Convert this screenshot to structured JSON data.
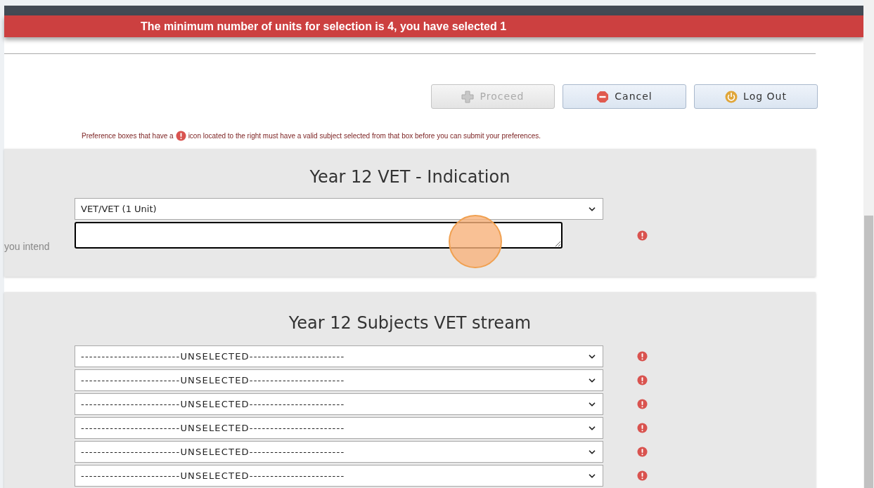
{
  "alert": {
    "message": "The minimum number of units for selection is 4, you have selected 1"
  },
  "buttons": [
    {
      "kind": "plus",
      "label": "Proceed",
      "disabled": true
    },
    {
      "kind": "stop",
      "label": "Cancel",
      "disabled": false
    },
    {
      "kind": "power",
      "label": "Log Out",
      "disabled": false
    }
  ],
  "note": {
    "before": "Preference boxes that have a",
    "after": "icon located to the right must have a valid subject selected from that box before you can submit your preferences."
  },
  "sections": [
    {
      "title": "Year 12 VET - Indication",
      "side_label": "you intend",
      "rows": [
        {
          "kind": "dropdown",
          "value": "VET/VET (1 Unit)",
          "warning": false
        },
        {
          "kind": "textarea",
          "value": "",
          "warning": true
        }
      ]
    },
    {
      "title": "Year 12 Subjects VET stream",
      "rows": [
        {
          "kind": "dropdown",
          "value": "------------------------UNSELECTED-----------------------",
          "warning": true
        },
        {
          "kind": "dropdown",
          "value": "------------------------UNSELECTED-----------------------",
          "warning": true
        },
        {
          "kind": "dropdown",
          "value": "------------------------UNSELECTED-----------------------",
          "warning": true
        },
        {
          "kind": "dropdown",
          "value": "------------------------UNSELECTED-----------------------",
          "warning": true
        },
        {
          "kind": "dropdown",
          "value": "------------------------UNSELECTED-----------------------",
          "warning": true
        },
        {
          "kind": "dropdown",
          "value": "------------------------UNSELECTED-----------------------",
          "warning": true
        }
      ]
    }
  ]
}
